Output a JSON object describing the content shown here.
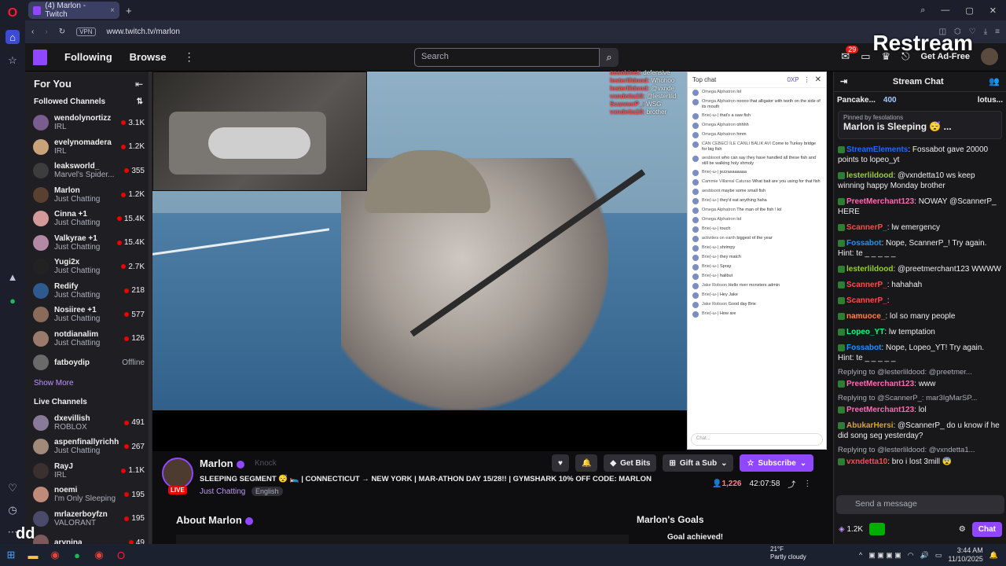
{
  "browser": {
    "tab_title": "(4) Marlon - Twitch",
    "url": "www.twitch.tv/marlon",
    "vpn_label": "VPN"
  },
  "topnav": {
    "following": "Following",
    "browse": "Browse",
    "search_placeholder": "Search",
    "notif_count": "29",
    "get_ad_free": "Get Ad-Free",
    "overlay_brand": "Restream"
  },
  "leftcol": {
    "for_you": "For You",
    "followed_channels": "Followed Channels",
    "followed": [
      {
        "name": "wendolynortizz",
        "category": "IRL",
        "viewers": "3.1K",
        "color": "#7b5c8e"
      },
      {
        "name": "evelynomadera",
        "category": "IRL",
        "viewers": "1.2K",
        "color": "#c9a27a"
      },
      {
        "name": "leaksworld_",
        "category": "Marvel's Spider...",
        "viewers": "355",
        "color": "#3d3d3d"
      },
      {
        "name": "Marlon",
        "category": "Just Chatting",
        "viewers": "1.2K",
        "color": "#5a4030"
      },
      {
        "name": "Cinna +1",
        "category": "Just Chatting",
        "viewers": "15.4K",
        "color": "#d49a9a"
      },
      {
        "name": "Valkyrae +1",
        "category": "Just Chatting",
        "viewers": "15.4K",
        "color": "#b38aa6"
      },
      {
        "name": "Yugi2x",
        "category": "Just Chatting",
        "viewers": "2.7K",
        "color": "#222"
      },
      {
        "name": "Redify",
        "category": "Just Chatting",
        "viewers": "218",
        "color": "#2f5a8e"
      },
      {
        "name": "Nosiiree +1",
        "category": "Just Chatting",
        "viewers": "577",
        "color": "#8a6b5a"
      },
      {
        "name": "notdianalim",
        "category": "Just Chatting",
        "viewers": "126",
        "color": "#9a7a6a"
      },
      {
        "name": "fatboydip",
        "category": "",
        "viewers": "Offline",
        "color": "#6a6a6a"
      }
    ],
    "show_more": "Show More",
    "live_channels": "Live Channels",
    "live": [
      {
        "name": "dxevillish",
        "category": "ROBLOX",
        "viewers": "491",
        "color": "#8a7a9a"
      },
      {
        "name": "aspenfinallyrichh",
        "category": "Just Chatting",
        "viewers": "267",
        "color": "#a08a7a"
      },
      {
        "name": "RayJ",
        "category": "IRL",
        "viewers": "1.1K",
        "color": "#3a3030"
      },
      {
        "name": "noemi",
        "category": "I'm Only Sleeping",
        "viewers": "195",
        "color": "#c08a7a"
      },
      {
        "name": "mrlazerboyfzn",
        "category": "VALORANT",
        "viewers": "195",
        "color": "#4a4a6a"
      },
      {
        "name": "arynina",
        "category": "",
        "viewers": "49",
        "color": "#7a5a5a"
      }
    ]
  },
  "overlay_chat": {
    "lines": [
      {
        "user": "aesobinet:",
        "text": "defensive"
      },
      {
        "user": "lesterlildood:",
        "text": "Whohoo"
      },
      {
        "user": "lesterlildood:",
        "text": "@vxnde"
      },
      {
        "user": "vxndetta10:",
        "text": "@lesterlild"
      },
      {
        "user": "ScannerP_:",
        "text": "WSG"
      },
      {
        "user": "vxndetta10:",
        "text": "brother"
      }
    ]
  },
  "popup": {
    "header": "Top chat",
    "xp": "0XP",
    "messages": [
      {
        "user": "Omega Alphatron",
        "text": "lol"
      },
      {
        "user": "Omega Alphatron",
        "text": "noooo that alligator with teeth on the side of its mouth"
      },
      {
        "user": "Brie(-ω-)",
        "text": "that's a saw fish"
      },
      {
        "user": "Omega Alphatron",
        "text": "ohhhh"
      },
      {
        "user": "Omega Alphatron",
        "text": "hmm"
      },
      {
        "user": "CAN CEBECİ İLE CANLI BALIK AVI",
        "text": "Come to Turkey bridge for big fish"
      },
      {
        "user": "aesbisoot",
        "text": "who can say they have handled all these fish and still be walking holy shmoly"
      },
      {
        "user": "Brie(-ω-)",
        "text": "jezzasaaaaaa"
      },
      {
        "user": "Cammie Villareal Caturao",
        "text": "What bait are you using for that fish"
      },
      {
        "user": "aesbisoot",
        "text": "maybe some small fish"
      },
      {
        "user": "Brie(-ω-)",
        "text": "they'd eat anything haha"
      },
      {
        "user": "Omega Alphatron",
        "text": "The man of the fish ! lol"
      },
      {
        "user": "Omega Alphatron",
        "text": "lol"
      },
      {
        "user": "Brie(-ω-)",
        "text": "touch"
      },
      {
        "user": "activities on earth",
        "text": "biggest of the year"
      },
      {
        "user": "Brie(-ω-)",
        "text": "shrimpy"
      },
      {
        "user": "Brie(-ω-)",
        "text": "they match"
      },
      {
        "user": "Brie(-ω-)",
        "text": "Spray"
      },
      {
        "user": "Brie(-ω-)",
        "text": "halibut"
      },
      {
        "user": "Jake Robson",
        "text": "Hello river monsters admin"
      },
      {
        "user": "Brie(-ω-)",
        "text": "Hey Jake"
      },
      {
        "user": "Jake Robson",
        "text": "Good day Brie"
      },
      {
        "user": "Brie(-ω-)",
        "text": "How are"
      }
    ],
    "chat_placeholder": "Chat..."
  },
  "channel": {
    "name": "Marlon",
    "knock": "Knock",
    "live_label": "LIVE",
    "title": "SLEEPING SEGMENT 😴 🛌 | CONNECTICUT → NEW YORK | MAR-ATHON DAY 15/28!! | GYMSHARK 10% OFF CODE: MARLON",
    "category": "Just Chatting",
    "language": "English",
    "get_bits": "Get Bits",
    "gift_a_sub": "Gift a Sub",
    "subscribe": "Subscribe",
    "viewers": "1,226",
    "uptime": "42:07:58",
    "about": "About Marlon",
    "goals": "Marlon's Goals",
    "goal_achieved": "Goal achieved!"
  },
  "rchat": {
    "title": "Stream Chat",
    "bar_user": "Pancake...",
    "bar_count": "400",
    "bar_user2": "lotus...",
    "pinned_by": "Pinned by",
    "pinned_user": "fesolations",
    "pinned_text": "Marlon is Sleeping 😴 ...",
    "messages": [
      {
        "user": "StreamElements",
        "color": "#1e69ff",
        "text": ": Fossabot gave 20000 points to lopeo_yt"
      },
      {
        "user": "lesterlildood",
        "color": "#9acd32",
        "text": ": @vxndetta10 ws keep winning happy Monday brother"
      },
      {
        "user": "PreetMerchant123",
        "color": "#ff69b4",
        "text": ": NOWAY @ScannerP_ HERE"
      },
      {
        "user": "ScannerP_",
        "color": "#ff4a4a",
        "text": ": lw emergency"
      },
      {
        "user": "Fossabot",
        "color": "#1e90ff",
        "text": ": Nope, ScannerP_! Try again. Hint: te _ _ _ _ _"
      },
      {
        "user": "lesterlildood",
        "color": "#9acd32",
        "text": ": @preetmerchant123 WWWW"
      },
      {
        "user": "ScannerP_",
        "color": "#ff4a4a",
        "text": ": hahahah"
      },
      {
        "user": "ScannerP_",
        "color": "#ff4a4a",
        "text": ":"
      },
      {
        "user": "namuoce_",
        "color": "#ff7f50",
        "text": ": lol so many people"
      },
      {
        "user": "Lopeo_YT",
        "color": "#00ff7f",
        "text": ": lw temptation"
      },
      {
        "user": "Fossabot",
        "color": "#1e90ff",
        "text": ": Nope, Lopeo_YT! Try again. Hint: te _ _ _ _ _"
      }
    ],
    "replies": [
      {
        "reply_to": "Replying to @lesterlildood: @preetmer...",
        "user": "PreetMerchant123",
        "color": "#ff69b4",
        "text": ": www"
      },
      {
        "reply_to": "Replying to @ScannerP_: mar3IgMarSP...",
        "user": "PreetMerchant123",
        "color": "#ff69b4",
        "text": ": lol"
      }
    ],
    "last_messages": [
      {
        "user": "AbukarHersi",
        "color": "#daa520",
        "text": ": @ScannerP_ do u know if he did song seg yesterday?"
      }
    ],
    "final_reply": {
      "reply_to": "Replying to @lesterlildood: @vxndetta1...",
      "user": "vxndetta10",
      "color": "#ff4a4a",
      "text": ": bro i lost 3mill 😨"
    },
    "send_placeholder": "Send a message",
    "points": "1.2K",
    "chat_button": "Chat"
  },
  "taskbar": {
    "temp": "21°F",
    "weather": "Partly cloudy",
    "time": "3:44 AM",
    "date": "11/10/2025"
  },
  "overlay_text": "dd",
  "icons": {
    "accent": "#9147ff",
    "live": "#eb0400"
  }
}
